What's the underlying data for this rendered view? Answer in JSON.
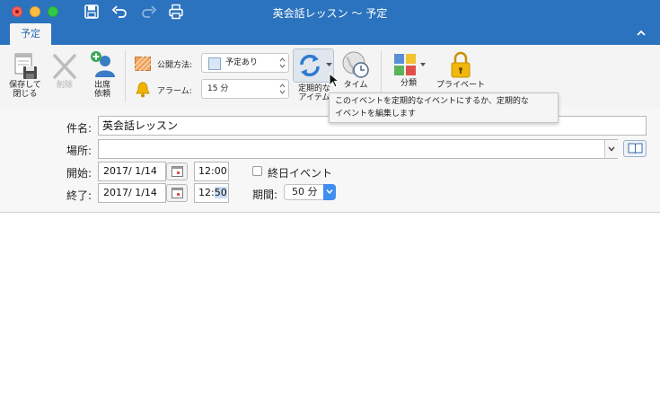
{
  "window": {
    "title": "英会話レッスン 〜 予定"
  },
  "quick_access": {
    "icons": [
      "save-icon",
      "undo-icon",
      "redo-icon",
      "print-icon"
    ]
  },
  "ribbon": {
    "tab_label": "予定",
    "save_close_label_1": "保存して",
    "save_close_label_2": "閉じる",
    "delete_label": "削除",
    "invite_label_1": "出席",
    "invite_label_2": "依頼",
    "show_as_label": "公開方法:",
    "show_as_value": "予定あり",
    "reminder_label": "アラーム:",
    "reminder_value": "15 分",
    "recurrence_label_1": "定期的な",
    "recurrence_label_2": "アイテム",
    "timezone_label": "タイム",
    "categorize_label": "分類",
    "private_label": "プライベート"
  },
  "tooltip": {
    "line1": "このイベントを定期的なイベントにするか、定期的な",
    "line2": "イベントを編集します"
  },
  "form": {
    "subject_label": "件名:",
    "subject_value": "英会話レッスン",
    "location_label": "場所:",
    "location_value": "",
    "start_label": "開始:",
    "start_date": "2017/  1/14",
    "start_time": "12:00",
    "allday_label": "終日イベント",
    "allday_checked": false,
    "end_label": "終了:",
    "end_date": "2017/  1/14",
    "end_time_hour": "12:",
    "end_time_min": "50",
    "duration_label": "期間:",
    "duration_value": "50 分"
  },
  "colors": {
    "title_bar": "#2b73be",
    "accent": "#3f8ef0",
    "ribbon_bg": "#f4f4f4"
  }
}
